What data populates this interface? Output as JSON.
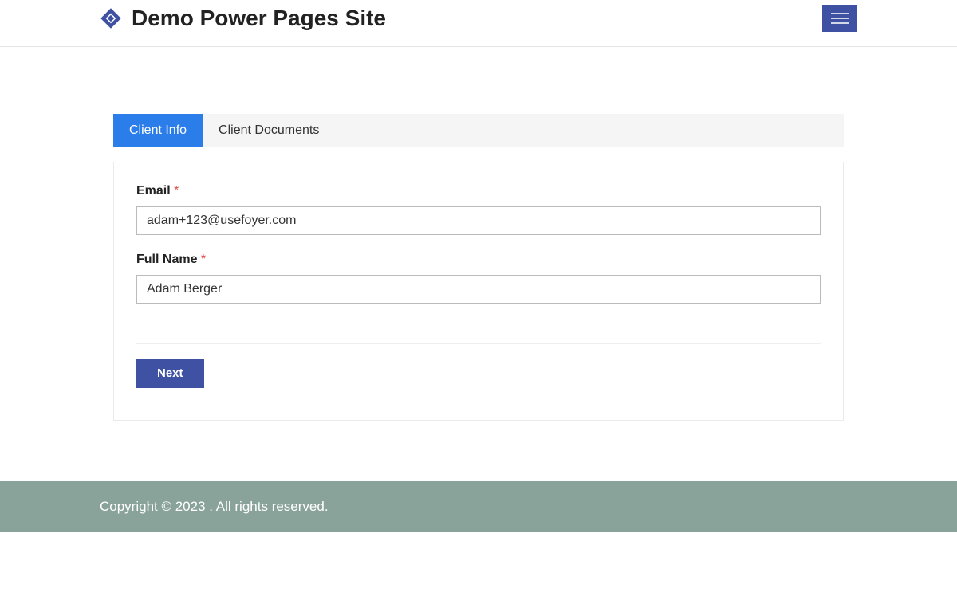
{
  "header": {
    "title": "Demo Power Pages Site"
  },
  "tabs": {
    "client_info": "Client Info",
    "client_documents": "Client Documents"
  },
  "form": {
    "email_label": "Email",
    "email_value": "adam+123@usefoyer.com",
    "fullname_label": "Full Name",
    "fullname_value": "Adam Berger",
    "required_mark": "*",
    "next_label": "Next"
  },
  "footer": {
    "copyright": "Copyright © 2023 . All rights reserved."
  }
}
